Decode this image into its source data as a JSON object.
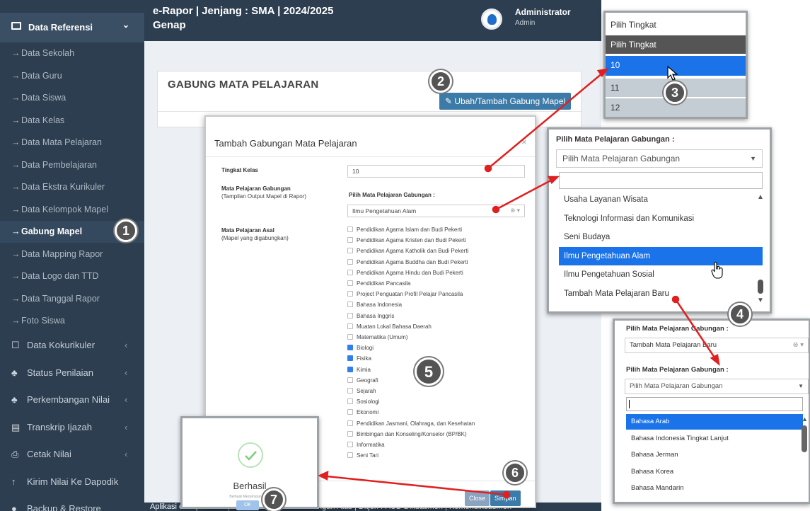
{
  "app": {
    "title_line1": "e-Rapor | Jenjang : SMA | 2024/2025",
    "title_line2": "Genap",
    "user": "Administrator",
    "role": "Admin"
  },
  "sidebar": {
    "header": "Data Referensi",
    "items": [
      "Data Sekolah",
      "Data Guru",
      "Data Siswa",
      "Data Kelas",
      "Data Mata Pelajaran",
      "Data Pembelajaran",
      "Data Ekstra Kurikuler",
      "Data Kelompok Mapel",
      "Gabung Mapel",
      "Data Mapping Rapor",
      "Data Logo dan TTD",
      "Data Tanggal Rapor",
      "Foto Siswa"
    ],
    "groups": [
      "Data Kokurikuler",
      "Status Penilaian",
      "Perkembangan Nilai",
      "Transkrip Ijazah",
      "Cetak Nilai",
      "Kirim Nilai Ke Dapodik",
      "Backup & Restore"
    ]
  },
  "page": {
    "heading": "GABUNG MATA PELAJARAN",
    "action_button": "Ubah/Tambah Gabung Mapel"
  },
  "footer": "Aplikasi e-Rapor SMA | Direktorat Sekolah Menengah Atas | Ditjen PAUD Dikdasmen | Kemendikdasmen",
  "modal": {
    "title": "Tambah Gabungan Mata Pelajaran",
    "tingkat_label": "Tingkat Kelas",
    "tingkat_value": "10",
    "gabungan_label": "Mata Pelajaran Gabungan",
    "gabungan_sub": "(Tampilan Output Mapel di Rapor)",
    "gabungan_select_label": "Pilih Mata Pelajaran Gabungan :",
    "gabungan_value": "Ilmu Pengetahuan Alam",
    "asal_label": "Mata Pelajaran Asal",
    "asal_sub": "(Mapel yang digabungkan)",
    "subjects": [
      {
        "name": "Pendidikan Agama Islam dan Budi Pekerti",
        "checked": false
      },
      {
        "name": "Pendidikan Agama Kristen dan Budi Pekerti",
        "checked": false
      },
      {
        "name": "Pendidikan Agama Katholik dan Budi Pekerti",
        "checked": false
      },
      {
        "name": "Pendidikan Agama Buddha dan Budi Pekerti",
        "checked": false
      },
      {
        "name": "Pendidikan Agama Hindu dan Budi Pekerti",
        "checked": false
      },
      {
        "name": "Pendidikan Pancasila",
        "checked": false
      },
      {
        "name": "Project Penguatan Profil Pelajar Pancasila",
        "checked": false
      },
      {
        "name": "Bahasa Indonesia",
        "checked": false
      },
      {
        "name": "Bahasa Inggris",
        "checked": false
      },
      {
        "name": "Muatan Lokal Bahasa Daerah",
        "checked": false
      },
      {
        "name": "Matematika (Umum)",
        "checked": false
      },
      {
        "name": "Biologi",
        "checked": true
      },
      {
        "name": "Fisika",
        "checked": true
      },
      {
        "name": "Kimia",
        "checked": true
      },
      {
        "name": "Geografi",
        "checked": false
      },
      {
        "name": "Sejarah",
        "checked": false
      },
      {
        "name": "Sosiologi",
        "checked": false
      },
      {
        "name": "Ekonomi",
        "checked": false
      },
      {
        "name": "Pendidikan Jasmani, Olahraga, dan Kesehatan",
        "checked": false
      },
      {
        "name": "Bimbingan dan Konseling/Konselor (BP/BK)",
        "checked": false
      },
      {
        "name": "Informatika",
        "checked": false
      },
      {
        "name": "Seni Tari",
        "checked": false
      }
    ],
    "close_label": "Close",
    "save_label": "Simpan"
  },
  "tingkat_dropdown": {
    "header": "Pilih Tingkat",
    "options": [
      "Pilih Tingkat",
      "10",
      "11",
      "12"
    ],
    "selected": "10"
  },
  "mapel_dropdown": {
    "label": "Pilih Mata Pelajaran Gabungan :",
    "placeholder": "Pilih Mata Pelajaran Gabungan",
    "options": [
      "Usaha Layanan Wisata",
      "Teknologi Informasi dan Komunikasi",
      "Seni Budaya",
      "Ilmu Pengetahuan Alam",
      "Ilmu Pengetahuan Sosial",
      "Tambah Mata Pelajaran Baru"
    ],
    "highlighted": "Ilmu Pengetahuan Alam"
  },
  "new_mapel_dropdown": {
    "label1": "Pilih Mata Pelajaran Gabungan :",
    "value1": "Tambah Mata Pelajaran Baru",
    "label2": "Pilih Mata Pelajaran Gabungan :",
    "placeholder": "Pilih Mata Pelajaran Gabungan",
    "options": [
      "Bahasa Arab",
      "Bahasa Indonesia Tingkat Lanjut",
      "Bahasa Jerman",
      "Bahasa Korea",
      "Bahasa Mandarin"
    ],
    "highlighted": "Bahasa Arab"
  },
  "success_dialog": {
    "title": "Berhasil",
    "message": "Berhasil Menyimpan Data",
    "ok_label": "OK"
  },
  "steps": [
    "1",
    "2",
    "3",
    "4",
    "5",
    "6",
    "7"
  ],
  "colors": {
    "sidebar": "#2c3e50",
    "accent": "#1a73e8",
    "annotation_arrow": "#e02020",
    "success": "#7ccf7c"
  }
}
